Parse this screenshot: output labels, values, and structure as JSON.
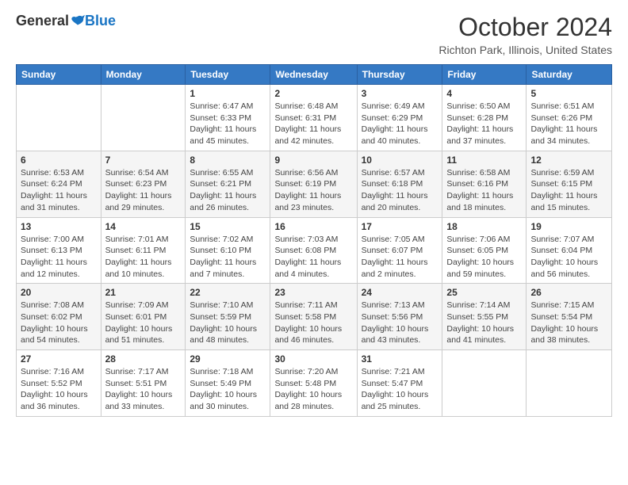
{
  "logo": {
    "general": "General",
    "blue": "Blue"
  },
  "title": "October 2024",
  "location": "Richton Park, Illinois, United States",
  "days_of_week": [
    "Sunday",
    "Monday",
    "Tuesday",
    "Wednesday",
    "Thursday",
    "Friday",
    "Saturday"
  ],
  "weeks": [
    [
      {
        "day": "",
        "info": ""
      },
      {
        "day": "",
        "info": ""
      },
      {
        "day": "1",
        "info": "Sunrise: 6:47 AM\nSunset: 6:33 PM\nDaylight: 11 hours and 45 minutes."
      },
      {
        "day": "2",
        "info": "Sunrise: 6:48 AM\nSunset: 6:31 PM\nDaylight: 11 hours and 42 minutes."
      },
      {
        "day": "3",
        "info": "Sunrise: 6:49 AM\nSunset: 6:29 PM\nDaylight: 11 hours and 40 minutes."
      },
      {
        "day": "4",
        "info": "Sunrise: 6:50 AM\nSunset: 6:28 PM\nDaylight: 11 hours and 37 minutes."
      },
      {
        "day": "5",
        "info": "Sunrise: 6:51 AM\nSunset: 6:26 PM\nDaylight: 11 hours and 34 minutes."
      }
    ],
    [
      {
        "day": "6",
        "info": "Sunrise: 6:53 AM\nSunset: 6:24 PM\nDaylight: 11 hours and 31 minutes."
      },
      {
        "day": "7",
        "info": "Sunrise: 6:54 AM\nSunset: 6:23 PM\nDaylight: 11 hours and 29 minutes."
      },
      {
        "day": "8",
        "info": "Sunrise: 6:55 AM\nSunset: 6:21 PM\nDaylight: 11 hours and 26 minutes."
      },
      {
        "day": "9",
        "info": "Sunrise: 6:56 AM\nSunset: 6:19 PM\nDaylight: 11 hours and 23 minutes."
      },
      {
        "day": "10",
        "info": "Sunrise: 6:57 AM\nSunset: 6:18 PM\nDaylight: 11 hours and 20 minutes."
      },
      {
        "day": "11",
        "info": "Sunrise: 6:58 AM\nSunset: 6:16 PM\nDaylight: 11 hours and 18 minutes."
      },
      {
        "day": "12",
        "info": "Sunrise: 6:59 AM\nSunset: 6:15 PM\nDaylight: 11 hours and 15 minutes."
      }
    ],
    [
      {
        "day": "13",
        "info": "Sunrise: 7:00 AM\nSunset: 6:13 PM\nDaylight: 11 hours and 12 minutes."
      },
      {
        "day": "14",
        "info": "Sunrise: 7:01 AM\nSunset: 6:11 PM\nDaylight: 11 hours and 10 minutes."
      },
      {
        "day": "15",
        "info": "Sunrise: 7:02 AM\nSunset: 6:10 PM\nDaylight: 11 hours and 7 minutes."
      },
      {
        "day": "16",
        "info": "Sunrise: 7:03 AM\nSunset: 6:08 PM\nDaylight: 11 hours and 4 minutes."
      },
      {
        "day": "17",
        "info": "Sunrise: 7:05 AM\nSunset: 6:07 PM\nDaylight: 11 hours and 2 minutes."
      },
      {
        "day": "18",
        "info": "Sunrise: 7:06 AM\nSunset: 6:05 PM\nDaylight: 10 hours and 59 minutes."
      },
      {
        "day": "19",
        "info": "Sunrise: 7:07 AM\nSunset: 6:04 PM\nDaylight: 10 hours and 56 minutes."
      }
    ],
    [
      {
        "day": "20",
        "info": "Sunrise: 7:08 AM\nSunset: 6:02 PM\nDaylight: 10 hours and 54 minutes."
      },
      {
        "day": "21",
        "info": "Sunrise: 7:09 AM\nSunset: 6:01 PM\nDaylight: 10 hours and 51 minutes."
      },
      {
        "day": "22",
        "info": "Sunrise: 7:10 AM\nSunset: 5:59 PM\nDaylight: 10 hours and 48 minutes."
      },
      {
        "day": "23",
        "info": "Sunrise: 7:11 AM\nSunset: 5:58 PM\nDaylight: 10 hours and 46 minutes."
      },
      {
        "day": "24",
        "info": "Sunrise: 7:13 AM\nSunset: 5:56 PM\nDaylight: 10 hours and 43 minutes."
      },
      {
        "day": "25",
        "info": "Sunrise: 7:14 AM\nSunset: 5:55 PM\nDaylight: 10 hours and 41 minutes."
      },
      {
        "day": "26",
        "info": "Sunrise: 7:15 AM\nSunset: 5:54 PM\nDaylight: 10 hours and 38 minutes."
      }
    ],
    [
      {
        "day": "27",
        "info": "Sunrise: 7:16 AM\nSunset: 5:52 PM\nDaylight: 10 hours and 36 minutes."
      },
      {
        "day": "28",
        "info": "Sunrise: 7:17 AM\nSunset: 5:51 PM\nDaylight: 10 hours and 33 minutes."
      },
      {
        "day": "29",
        "info": "Sunrise: 7:18 AM\nSunset: 5:49 PM\nDaylight: 10 hours and 30 minutes."
      },
      {
        "day": "30",
        "info": "Sunrise: 7:20 AM\nSunset: 5:48 PM\nDaylight: 10 hours and 28 minutes."
      },
      {
        "day": "31",
        "info": "Sunrise: 7:21 AM\nSunset: 5:47 PM\nDaylight: 10 hours and 25 minutes."
      },
      {
        "day": "",
        "info": ""
      },
      {
        "day": "",
        "info": ""
      }
    ]
  ]
}
